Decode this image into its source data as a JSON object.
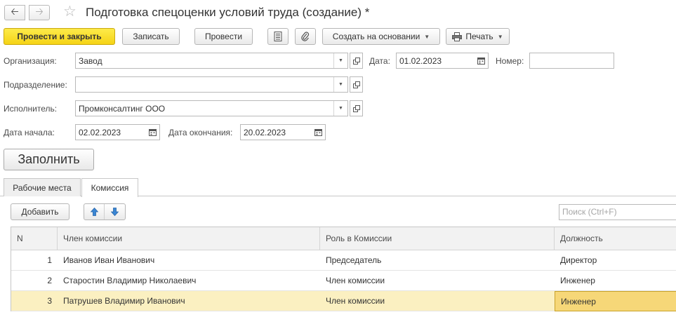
{
  "window": {
    "title": "Подготовка спецоценки условий труда (создание) *",
    "icons": {
      "back": "arrow-left",
      "forward": "arrow-right",
      "favorite": "star-outline"
    }
  },
  "toolbar": {
    "post_and_close": "Провести и закрыть",
    "save": "Записать",
    "post": "Провести",
    "create_based_on": "Создать на основании",
    "print": "Печать"
  },
  "form": {
    "organization_label": "Организация:",
    "organization_value": "Завод",
    "date_label": "Дата:",
    "date_value": "01.02.2023",
    "number_label": "Номер:",
    "number_value": "",
    "department_label": "Подразделение:",
    "department_value": "",
    "executor_label": "Исполнитель:",
    "executor_value": "Промконсалтинг ООО",
    "start_label": "Дата начала:",
    "start_value": "02.02.2023",
    "end_label": "Дата окончания:",
    "end_value": "20.02.2023"
  },
  "fill_button": "Заполнить",
  "tabs": [
    {
      "label": "Рабочие места",
      "active": false
    },
    {
      "label": "Комиссия",
      "active": true
    }
  ],
  "commission": {
    "add_button": "Добавить",
    "search_placeholder": "Поиск (Ctrl+F)",
    "columns": [
      "N",
      "Член комиссии",
      "Роль в Комиссии",
      "Должность"
    ],
    "rows": [
      {
        "n": "1",
        "member": "Иванов Иван Иванович",
        "role": "Председатель",
        "position": "Директор"
      },
      {
        "n": "2",
        "member": "Старостин Владимир Николаевич",
        "role": "Член комиссии",
        "position": "Инженер"
      },
      {
        "n": "3",
        "member": "Патрушев Владимир Иванович",
        "role": "Член комиссии",
        "position": "Инженер"
      }
    ],
    "selected_row": 3
  },
  "colors": {
    "primary_button": "#f5d316",
    "selected_row": "#fbf0c1",
    "current_cell": "#f6d778",
    "move_arrow": "#3a86d4"
  }
}
